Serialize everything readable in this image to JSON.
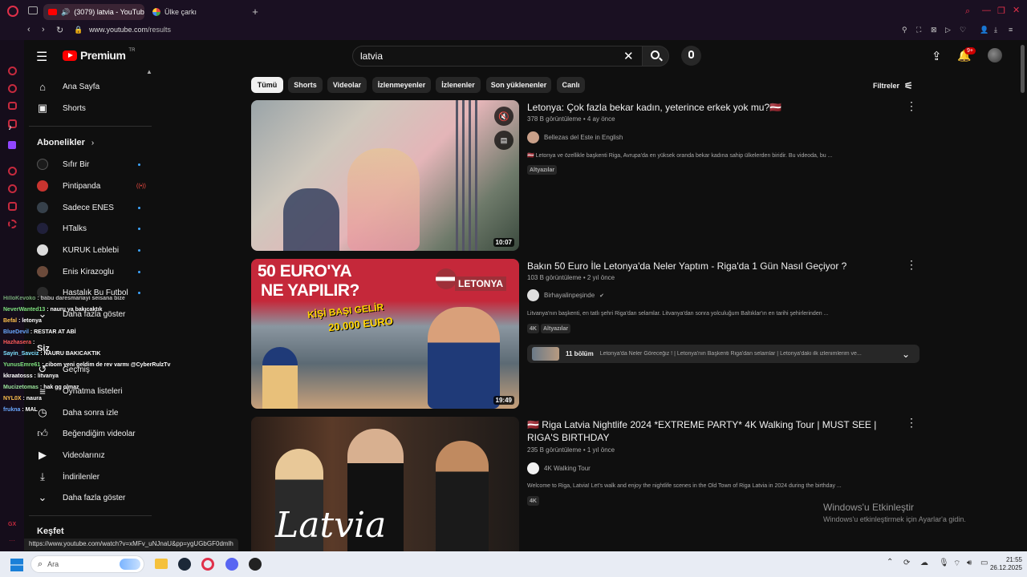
{
  "browser": {
    "tabs": [
      {
        "title": "(3079) latvia - YouTub",
        "active": true
      },
      {
        "title": "Ülke çarkı",
        "active": false
      }
    ],
    "url_host": "www.youtube.com",
    "url_path": "/results",
    "badge_count": "9+"
  },
  "youtube": {
    "logo": "Premium",
    "logo_sup": "TR",
    "search_value": "latvia",
    "filters_label": "Filtreler"
  },
  "sidebar": {
    "items": [
      {
        "label": "Ana Sayfa",
        "icon": "home-icon"
      },
      {
        "label": "Shorts",
        "icon": "shorts-icon"
      }
    ],
    "subscriptions_header": "Abonelikler",
    "subscriptions": [
      {
        "label": "Sıfır Bir",
        "color": "#1b1b1b",
        "status": "dot"
      },
      {
        "label": "Pintipanda",
        "color": "#c8342f",
        "status": "live"
      },
      {
        "label": "Sadece ENES",
        "color": "#36404a",
        "status": "dot"
      },
      {
        "label": "HTalks",
        "color": "#20203a",
        "status": "dot"
      },
      {
        "label": "KURUK Leblebi",
        "color": "#dcdcdc",
        "status": "dot"
      },
      {
        "label": "Enis Kirazoglu",
        "color": "#6b4a3a",
        "status": "dot"
      },
      {
        "label": "Hastalık Bu Futbol",
        "color": "#2b2b2b",
        "status": "dot"
      }
    ],
    "show_more_1": "Daha fazla göster",
    "you_header": "Siz",
    "you_items": [
      {
        "label": "Geçmiş",
        "icon": "history-icon"
      },
      {
        "label": "Oynatma listeleri",
        "icon": "playlist-icon"
      },
      {
        "label": "Daha sonra izle",
        "icon": "clock-icon"
      },
      {
        "label": "Beğendiğim videolar",
        "icon": "thumbs-up-icon"
      },
      {
        "label": "Videolarınız",
        "icon": "video-icon"
      },
      {
        "label": "İndirilenler",
        "icon": "download-icon"
      },
      {
        "label": "Daha fazla göster",
        "icon": "chevron-down-icon"
      }
    ],
    "explore_header": "Keşfet"
  },
  "chat": [
    {
      "user": "HilloKevoko",
      "msg": " : babu daresmariayi seisana bize",
      "color": "#9be49b"
    },
    {
      "user": "NeverWanted13",
      "msg": " : nauru ya bakıcaktık",
      "color": "#7ee07e"
    },
    {
      "user": "Befal",
      "msg": " : letonya",
      "color": "#ffc04d"
    },
    {
      "user": "BlueDevil",
      "msg": " : RESTAR AT ABİ",
      "color": "#6aa8ff"
    },
    {
      "user": "Hazhasera",
      "msg": " :",
      "color": "#ff5a5a"
    },
    {
      "user": "Sayin_Savciz",
      "msg": " : NAURU BAKICAKTIK",
      "color": "#7ee0ff"
    },
    {
      "user": "YunusEmre61",
      "msg": " : cibom yeni geldim de rev varmı @CyberRulzTv",
      "color": "#7ee07e"
    },
    {
      "user": "kkraatosss",
      "msg": " : litvanya",
      "color": "#ffffff"
    },
    {
      "user": "Mucizetomas",
      "msg": " : hak gg olmaz",
      "color": "#9be49b"
    },
    {
      "user": "NYL0X",
      "msg": " : naura",
      "color": "#ffc04d"
    },
    {
      "user": "frukna",
      "msg": " : MAL",
      "color": "#6aa8ff"
    }
  ],
  "chips": [
    "Tümü",
    "Shorts",
    "Videolar",
    "İzlenmeyenler",
    "İzlenenler",
    "Son yüklenenler",
    "Canlı"
  ],
  "results": [
    {
      "title": "Letonya: Çok fazla bekar kadın, yeterince erkek yok mu?🇱🇻",
      "views": "378 B görüntüleme",
      "age": "4 ay önce",
      "channel": "Bellezas del Este in English",
      "description": "🇱🇻 Letonya ve özellikle başkenti Riga, Avrupa'da en yüksek oranda bekar kadına sahip ülkelerden biridir. Bu videoda, bu ...",
      "badges": [
        "Altyazılar"
      ],
      "duration": "10:07"
    },
    {
      "title": "Bakın 50 Euro İle Letonya'da Neler Yaptım - Riga'da 1 Gün Nasıl Geçiyor ?",
      "views": "103 B görüntüleme",
      "age": "2 yıl önce",
      "channel": "Birhayalinpeşinde",
      "description": "Litvanya'nın başkenti, en tatlı şehri Riga'dan selamlar. Litvanya'dan sonra yolculuğum Baltıklar'ın en tarihi şehirlerinden ...",
      "badges": [
        "4K",
        "Altyazılar"
      ],
      "duration": "19:49",
      "chapters_label": "11 bölüm",
      "chapters_text": "Letonya'da Neler Göreceğiz ! | Letonya'nın Başkenti Riga'dan selamlar | Letonya'daki ilk izlenimlerim ve...",
      "thumb_text_1": "50 EURO'YA",
      "thumb_text_2": "NE YAPILIR?",
      "thumb_text_3": "KİŞİ BAŞI GELİR",
      "thumb_text_4": "20.000 EURO",
      "thumb_flag": "LETONYA"
    },
    {
      "title": "🇱🇻 Riga Latvia Nightlife 2024 *EXTREME PARTY* 4K Walking Tour | MUST SEE | RIGA'S BIRTHDAY",
      "views": "235 B görüntüleme",
      "age": "1 yıl önce",
      "channel": "4K Walking Tour",
      "description": "Welcome to Riga, Latvia! Let's walk and enjoy the nightlife scenes in the Old Town of Riga Latvia in 2024 during the birthday ...",
      "badges": [
        "4K"
      ],
      "thumb_script": "Latvia"
    }
  ],
  "status_url": "https://www.youtube.com/watch?v=xMFv_uNJnaU&pp=ygUGbGF0dmlh",
  "watermark": {
    "line1": "Windows'u Etkinleştir",
    "line2": "Windows'u etkinleştirmek için Ayarlar'a gidin."
  },
  "taskbar": {
    "search_placeholder": "Ara",
    "time": "21:55",
    "date": "26.12.2025"
  }
}
